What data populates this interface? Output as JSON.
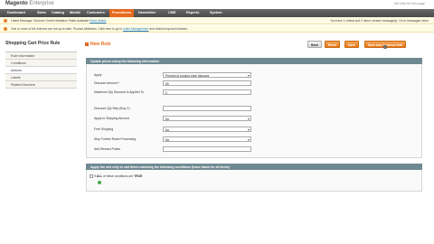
{
  "header": {
    "logo_brand": "Magento",
    "logo_edition": "Enterprise",
    "right_text": "Get help for this page"
  },
  "nav": {
    "items": [
      "Dashboard",
      "Sales",
      "Catalog",
      "Mobile",
      "Customers",
      "Promotions",
      "Newsletter",
      "CMS",
      "Reports",
      "System"
    ],
    "active_index": 5
  },
  "messages": [
    {
      "text": "Latest Message: Discover Credit Validation Patch Available",
      "link": "Read details",
      "right": "You have 1 critical and 2 minor unread message(s). Go to messages inbox"
    },
    {
      "text": "One or more of the Indexes are not up to date: Product Attributes. Click here to go to",
      "link": "Index Management",
      "suffix": "and rebuild required indexes."
    }
  ],
  "sidebar": {
    "title": "Shopping Cart Price Rule",
    "tabs": [
      "Rule Information",
      "Conditions",
      "Actions",
      "Labels",
      "Related Banners"
    ],
    "active_tab": 2
  },
  "main": {
    "title": "New Rule",
    "buttons": {
      "back": "Back",
      "reset": "Reset",
      "save": "Save",
      "save_continue": "Save and Continue Edit"
    }
  },
  "actions_section": {
    "header": "Update prices using the following information",
    "fields": [
      {
        "label": "Apply",
        "value": "Percent of product price discount",
        "type": "select"
      },
      {
        "label": "Discount Amount *",
        "value": "50",
        "type": "input"
      },
      {
        "label": "Maximum Qty Discount is Applied To",
        "value": "0",
        "type": "input"
      },
      {
        "label": "Discount Qty Step (Buy X)",
        "value": "",
        "type": "input"
      },
      {
        "label": "Apply to Shipping Amount",
        "value": "No",
        "type": "select"
      },
      {
        "label": "Free Shipping",
        "value": "No",
        "type": "select"
      },
      {
        "label": "Stop Further Rules Processing",
        "value": "No",
        "type": "select"
      },
      {
        "label": "Add Reward Points",
        "value": "",
        "type": "input"
      }
    ]
  },
  "conditions_section": {
    "header": "Apply the rule only to cart items matching the following conditions (leave blank for all items)",
    "prefix": "If",
    "aggregator": "ALL",
    "middle": "of these conditions are",
    "value": "TRUE",
    "suffix": ":"
  },
  "colors": {
    "accent": "#e76a1d",
    "nav_bg": "#555555",
    "section_header": "#6f8992",
    "link": "#1e7ec8"
  }
}
